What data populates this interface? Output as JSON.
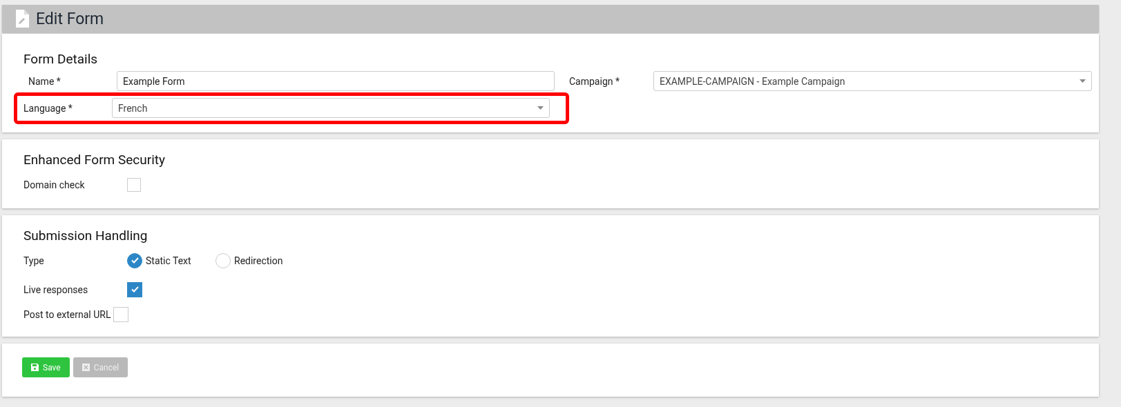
{
  "header": {
    "title": "Edit Form"
  },
  "form_details": {
    "title": "Form Details",
    "fields": [
      {
        "label": "Name *",
        "kind": "text",
        "value": "Example Form",
        "highlighted": false
      },
      {
        "label": "Campaign *",
        "kind": "select",
        "value": "EXAMPLE-CAMPAIGN - Example Campaign",
        "highlighted": false
      },
      {
        "label": "Language *",
        "kind": "select",
        "value": "French",
        "highlighted": true
      }
    ]
  },
  "security": {
    "title": "Enhanced Form Security",
    "domain_check": {
      "label": "Domain check",
      "checked": false
    }
  },
  "submission": {
    "title": "Submission Handling",
    "type": {
      "label": "Type",
      "options": [
        {
          "label": "Static Text",
          "selected": true
        },
        {
          "label": "Redirection",
          "selected": false
        }
      ]
    },
    "checkboxes": [
      {
        "label": "Live responses",
        "checked": true
      },
      {
        "label": "Post to external URL",
        "checked": false
      }
    ]
  },
  "buttons": [
    {
      "label": "Save",
      "kind": "save",
      "disabled": false
    },
    {
      "label": "Cancel",
      "kind": "cancel",
      "disabled": true
    }
  ]
}
